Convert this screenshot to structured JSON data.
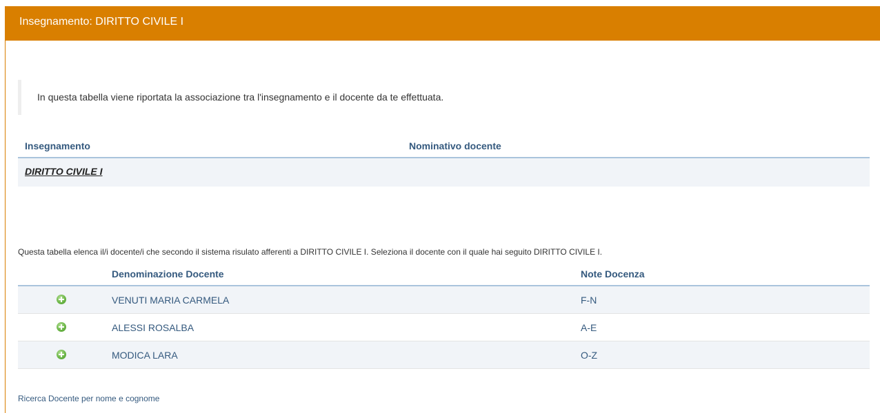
{
  "header": {
    "title": "Insegnamento: DIRITTO CIVILE I"
  },
  "intro_note": "In questa tabella viene riportata la associazione tra l'insegnamento e il docente da te effettuata.",
  "association_table": {
    "columns": [
      "Insegnamento",
      "Nominativo docente"
    ],
    "rows": [
      {
        "course": "DIRITTO CIVILE I",
        "teacher": ""
      }
    ]
  },
  "teachers_description": "Questa tabella elenca il/i docente/i che secondo il sistema risulato afferenti a DIRITTO CIVILE I. Seleziona il docente con il quale hai seguito DIRITTO CIVILE I.",
  "teachers_table": {
    "columns": [
      "",
      "Denominazione Docente",
      "Note Docenza"
    ],
    "rows": [
      {
        "icon": "add-circle-icon",
        "name": "VENUTI MARIA CARMELA",
        "note": "F-N"
      },
      {
        "icon": "add-circle-icon",
        "name": "ALESSI ROSALBA",
        "note": "A-E"
      },
      {
        "icon": "add-circle-icon",
        "name": "MODICA LARA",
        "note": "O-Z"
      }
    ]
  },
  "search_link": "Ricerca Docente per nome e cognome",
  "colors": {
    "header_bg": "#d97f00",
    "header_text": "#ffffff",
    "table_header_text": "#34597e",
    "row_alt_bg": "#f1f4f8"
  }
}
